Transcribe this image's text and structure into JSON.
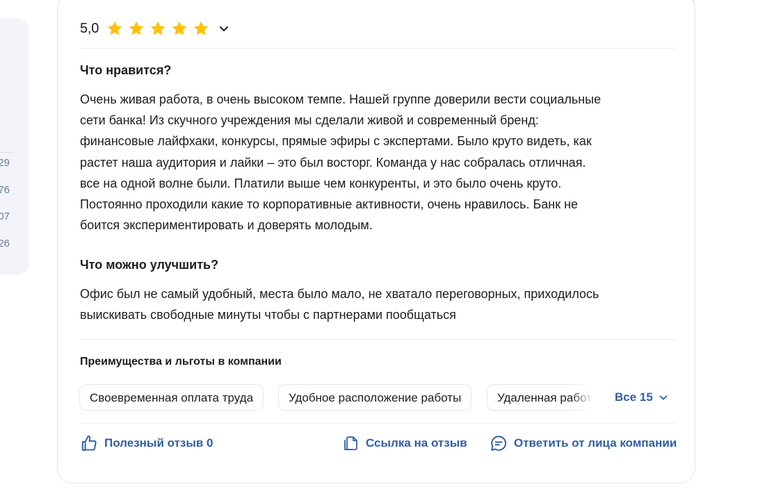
{
  "sidebar": {
    "values": [
      "29",
      "76",
      "07",
      "26"
    ]
  },
  "review": {
    "rating": "5,0",
    "stars": 5,
    "star_color": "#FFC107",
    "accent_color": "#2F5FA8",
    "likes_title": "Что нравится?",
    "likes_lines": [
      "Очень живая работа, в очень высоком темпе. Нашей группе доверили вести социальные",
      "сети банка! Из скучного учреждения мы сделали живой и современный бренд:",
      "финансовые лайфхаки, конкурсы, прямые эфиры с экспертами. Было круто видеть, как",
      "растет наша аудитория и лайки – это был восторг. Команда у нас собралась отличная.",
      "все на одной волне были. Платили выше чем конкуренты, и это было очень круто.",
      "Постоянно проходили какие то корпоративные активности, очень нравилось. Банк не",
      "боится экспериментировать и доверять молодым."
    ],
    "improve_title": "Что можно улучшить?",
    "improve_lines": [
      "Офис был не самый удобный, места было мало, не хватало переговорных, приходилось",
      "выискивать свободные минуты чтобы с партнерами пообщаться"
    ]
  },
  "benefits": {
    "title": "Преимущества и льготы в компании",
    "chips": [
      "Своевременная оплата труда",
      "Удобное расположение работы",
      "Удаленная работа"
    ],
    "all_label": "Все 15"
  },
  "actions": {
    "helpful": "Полезный отзыв 0",
    "link": "Ссылка на отзыв",
    "reply": "Ответить от лица компании"
  },
  "icons": [
    "star-icon",
    "chevron-down-icon",
    "thumbs-up-icon",
    "copy-link-icon",
    "chat-bubble-icon"
  ]
}
